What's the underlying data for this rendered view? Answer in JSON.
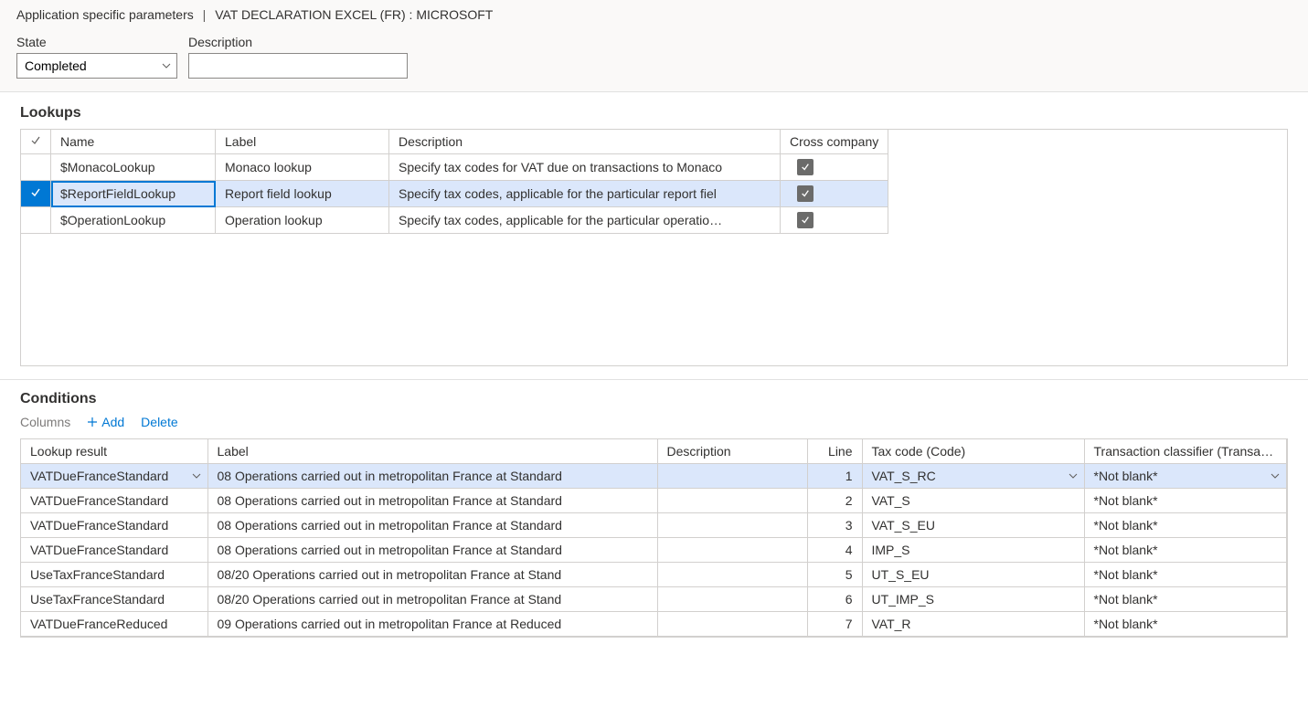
{
  "breadcrumb": {
    "item1": "Application specific parameters",
    "item2": "VAT DECLARATION EXCEL (FR) : MICROSOFT"
  },
  "fields": {
    "state_label": "State",
    "state_value": "Completed",
    "description_label": "Description",
    "description_value": ""
  },
  "lookups": {
    "title": "Lookups",
    "headers": {
      "name": "Name",
      "label": "Label",
      "description": "Description",
      "cross_company": "Cross company"
    },
    "rows": [
      {
        "selected": false,
        "name": "$MonacoLookup",
        "label": "Monaco lookup",
        "description": "Specify tax codes for VAT due on transactions to Monaco",
        "cross": true
      },
      {
        "selected": true,
        "name": "$ReportFieldLookup",
        "label": "Report field lookup",
        "description": "Specify tax codes, applicable for the particular report fiel",
        "cross": true
      },
      {
        "selected": false,
        "name": "$OperationLookup",
        "label": "Operation lookup",
        "description": "Specify tax codes, applicable for the particular operatio…",
        "cross": true
      }
    ]
  },
  "conditions": {
    "title": "Conditions",
    "toolbar": {
      "columns": "Columns",
      "add": "Add",
      "delete": "Delete"
    },
    "headers": {
      "lookup_result": "Lookup result",
      "label": "Label",
      "description": "Description",
      "line": "Line",
      "tax_code": "Tax code (Code)",
      "classifier": "Transaction classifier (Transacti…"
    },
    "rows": [
      {
        "selected": true,
        "lookup": "VATDueFranceStandard",
        "label": "08 Operations carried out in metropolitan France at Standard",
        "desc": "",
        "line": "1",
        "taxcode": "VAT_S_RC",
        "class": "*Not blank*"
      },
      {
        "selected": false,
        "lookup": "VATDueFranceStandard",
        "label": "08 Operations carried out in metropolitan France at Standard",
        "desc": "",
        "line": "2",
        "taxcode": "VAT_S",
        "class": "*Not blank*"
      },
      {
        "selected": false,
        "lookup": "VATDueFranceStandard",
        "label": "08 Operations carried out in metropolitan France at Standard",
        "desc": "",
        "line": "3",
        "taxcode": "VAT_S_EU",
        "class": "*Not blank*"
      },
      {
        "selected": false,
        "lookup": "VATDueFranceStandard",
        "label": "08 Operations carried out in metropolitan France at Standard",
        "desc": "",
        "line": "4",
        "taxcode": "IMP_S",
        "class": "*Not blank*"
      },
      {
        "selected": false,
        "lookup": "UseTaxFranceStandard",
        "label": "08/20 Operations carried out in metropolitan France at Stand",
        "desc": "",
        "line": "5",
        "taxcode": "UT_S_EU",
        "class": "*Not blank*"
      },
      {
        "selected": false,
        "lookup": "UseTaxFranceStandard",
        "label": "08/20 Operations carried out in metropolitan France at Stand",
        "desc": "",
        "line": "6",
        "taxcode": "UT_IMP_S",
        "class": "*Not blank*"
      },
      {
        "selected": false,
        "lookup": "VATDueFranceReduced",
        "label": "09 Operations carried out in metropolitan France at Reduced",
        "desc": "",
        "line": "7",
        "taxcode": "VAT_R",
        "class": "*Not blank*"
      }
    ]
  }
}
